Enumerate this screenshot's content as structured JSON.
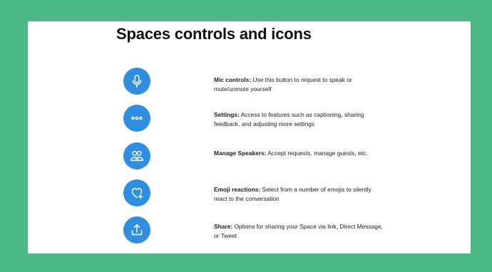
{
  "page": {
    "title": "Spaces controls and icons"
  },
  "colors": {
    "frame": "#4bb886",
    "panel": "#ffffff",
    "icon_bg": "#2f8ee0",
    "text": "#1b1b1b"
  },
  "items": [
    {
      "icon": "microphone-icon",
      "label": "Mic controls:",
      "text": " Use this button to request to speak or mute/unmute yourself"
    },
    {
      "icon": "more-dots-icon",
      "label": "Settings:",
      "text": " Access to features such as captioning, sharing feedback, and adjusting more settings"
    },
    {
      "icon": "people-icon",
      "label": "Manage Speakers:",
      "text": " Accept requests, manage guests, etc."
    },
    {
      "icon": "heart-add-icon",
      "label": "Emoji reactions:",
      "text": " Select from a number of emojis to silently react to the conversation"
    },
    {
      "icon": "share-icon",
      "label": "Share:",
      "text": " Options for sharing your Space via link, Direct Message, or Tweet"
    }
  ]
}
